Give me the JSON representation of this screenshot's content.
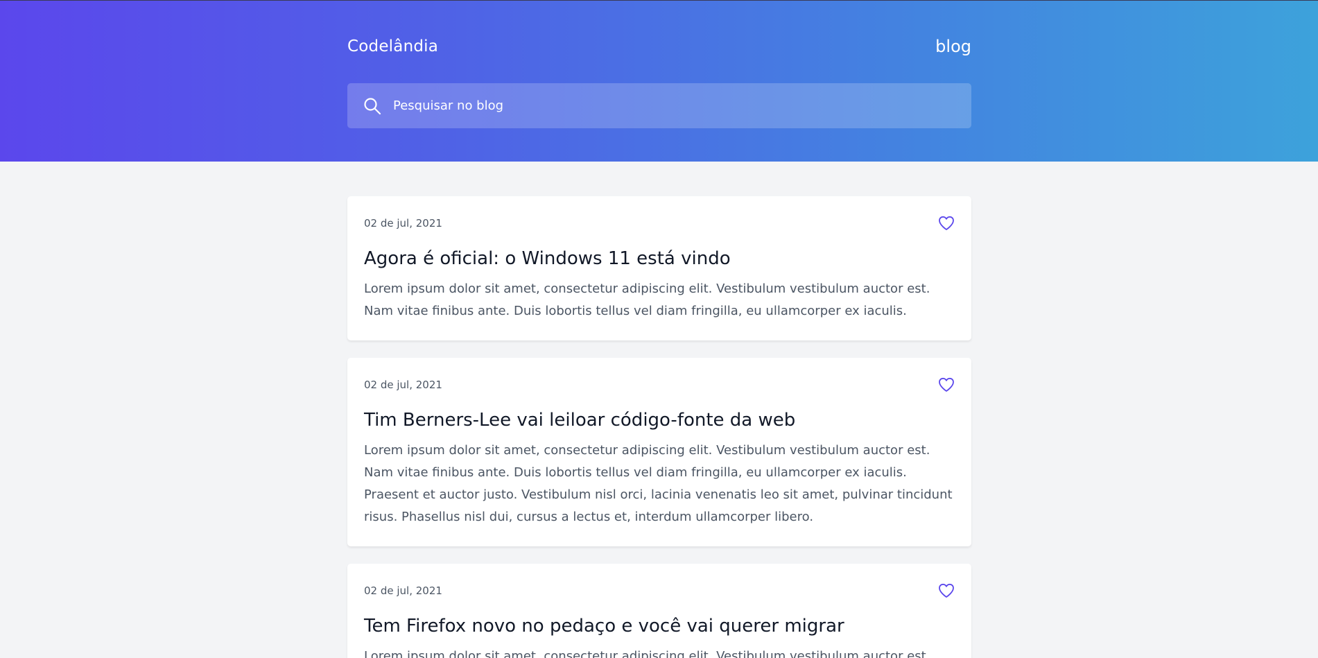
{
  "header": {
    "brand": "Codelândia",
    "nav_link": "blog",
    "search": {
      "placeholder": "Pesquisar no blog",
      "value": ""
    }
  },
  "colors": {
    "gradient_start": "#5b47ec",
    "gradient_end": "#3da2db",
    "heart": "#5b47ec",
    "page_bg": "#f3f4f6"
  },
  "posts": [
    {
      "date": "02 de jul, 2021",
      "title": "Agora é oficial: o Windows 11 está vindo",
      "body": "Lorem ipsum dolor sit amet, consectetur adipiscing elit. Vestibulum vestibulum auctor est. Nam vitae finibus ante. Duis lobortis tellus vel diam fringilla, eu ullamcorper ex iaculis.",
      "icon": "heart-outline"
    },
    {
      "date": "02 de jul, 2021",
      "title": "Tim Berners-Lee vai leiloar código-fonte da web",
      "body": "Lorem ipsum dolor sit amet, consectetur adipiscing elit. Vestibulum vestibulum auctor est. Nam vitae finibus ante. Duis lobortis tellus vel diam fringilla, eu ullamcorper ex iaculis. Praesent et auctor justo. Vestibulum nisl orci, lacinia venenatis leo sit amet, pulvinar tincidunt risus. Phasellus nisl dui, cursus a lectus et, interdum ullamcorper libero.",
      "icon": "heart-outline"
    },
    {
      "date": "02 de jul, 2021",
      "title": "Tem Firefox novo no pedaço e você vai querer migrar",
      "body": "Lorem ipsum dolor sit amet, consectetur adipiscing elit. Vestibulum vestibulum auctor est.",
      "icon": "heart-outline"
    }
  ]
}
